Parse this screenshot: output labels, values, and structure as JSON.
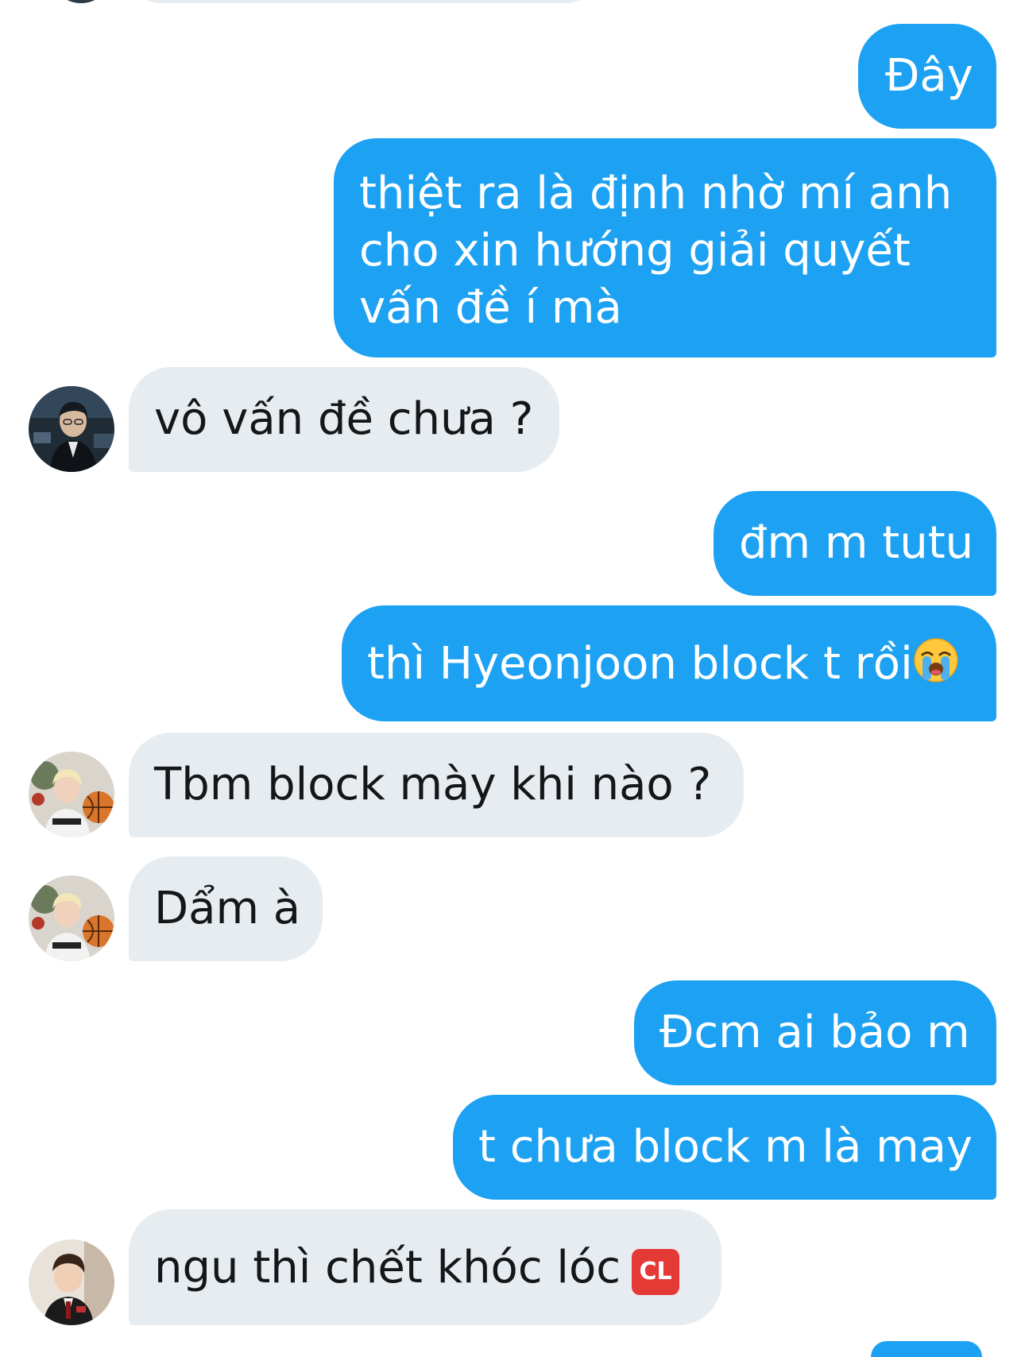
{
  "conversation": {
    "messages": [
      {
        "id": "m1",
        "direction": "outgoing",
        "text": "Đây"
      },
      {
        "id": "m2",
        "direction": "outgoing",
        "lines": [
          "thiệt ra là định nhờ mí anh",
          "cho xin hướng giải quyết",
          "vấn đề í mà"
        ]
      },
      {
        "id": "m3",
        "direction": "incoming",
        "text": "vô vấn đề chưa ?"
      },
      {
        "id": "m4",
        "direction": "outgoing",
        "text": "đm m tutu"
      },
      {
        "id": "m5",
        "direction": "outgoing",
        "text": "thì Hyeonjoon block t rồi",
        "emoji": "loudly-crying-face"
      },
      {
        "id": "m6",
        "direction": "incoming",
        "text": "Tbm block mày khi nào ?"
      },
      {
        "id": "m7",
        "direction": "incoming",
        "text": "Dẩm à"
      },
      {
        "id": "m8",
        "direction": "outgoing",
        "text": "Đcm ai bảo m"
      },
      {
        "id": "m9",
        "direction": "outgoing",
        "text": "t chưa block m là may"
      },
      {
        "id": "m10",
        "direction": "incoming",
        "text": "ngu thì chết khóc lóc",
        "badge": "CL"
      }
    ]
  },
  "colors": {
    "outgoing_bubble": "#1da1f2",
    "incoming_bubble": "#e6ecf0",
    "outgoing_text": "#ffffff",
    "incoming_text": "#14171a"
  },
  "icons": {
    "crying_emoji": "loudly-crying-face-icon",
    "cl_badge": "cl-button-icon"
  }
}
